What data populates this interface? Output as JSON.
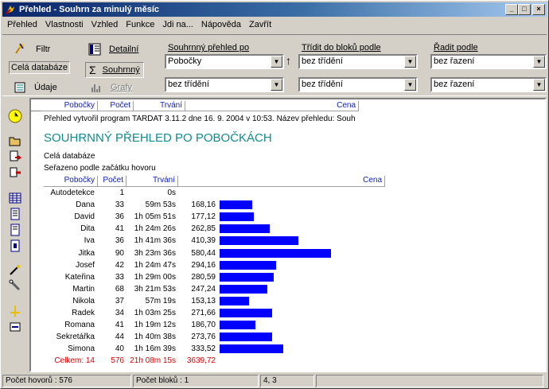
{
  "window": {
    "title": "Přehled - Souhrn za minulý měsíc",
    "min_label": "_",
    "max_label": "□",
    "close_label": "×"
  },
  "menu": [
    "Přehled",
    "Vlastnosti",
    "Vzhled",
    "Funkce",
    "Jdi na...",
    "Nápověda",
    "Zavřít"
  ],
  "toolbar": {
    "filter": "Filtr",
    "database": "Celá databáze",
    "data": "Údaje",
    "detail": "Detailní",
    "summary": "Souhrnný",
    "graphs": "Grafy",
    "summary_by_label": "Souhrnný přehled po",
    "summary_by_value": "Pobočky",
    "summary_by_2": "bez třídění",
    "sort_blocks_label": "Třídit do bloků podle",
    "sort_blocks_value": "bez třídění",
    "sort_blocks_2": "bez třídění",
    "order_label": "Řadit podle",
    "order_value": "bez řazení",
    "order_2": "bez řazení",
    "sort_arrow": "↑"
  },
  "header_strip": [
    "Pobočky",
    "Počet",
    "Trvání",
    "Cena"
  ],
  "report": {
    "info": "Přehled vytvořil program TARDAT 3.11.2 dne 16. 9. 2004 v 10:53. Název přehledu: Souh",
    "title": "SOUHRNNÝ PŘEHLED PO POBOČKÁCH",
    "scope": "Celá databáze",
    "sorted": "Seřazeno podle začátku hovoru",
    "columns": [
      "Pobočky",
      "Počet",
      "Trvání",
      "Cena"
    ],
    "rows": [
      {
        "name": "Autodetekce",
        "count": "1",
        "time": "0s",
        "price": "",
        "value": 0
      },
      {
        "name": "Dana",
        "count": "33",
        "time": "59m 53s",
        "price": "168,16",
        "value": 168.16
      },
      {
        "name": "David",
        "count": "36",
        "time": "1h 05m 51s",
        "price": "177,12",
        "value": 177.12
      },
      {
        "name": "Dita",
        "count": "41",
        "time": "1h 24m 26s",
        "price": "262,85",
        "value": 262.85
      },
      {
        "name": "Iva",
        "count": "36",
        "time": "1h 41m 36s",
        "price": "410,39",
        "value": 410.39
      },
      {
        "name": "Jitka",
        "count": "90",
        "time": "3h 23m 36s",
        "price": "580,44",
        "value": 580.44
      },
      {
        "name": "Josef",
        "count": "42",
        "time": "1h 24m 47s",
        "price": "294,16",
        "value": 294.16
      },
      {
        "name": "Kateřina",
        "count": "33",
        "time": "1h 29m 00s",
        "price": "280,59",
        "value": 280.59
      },
      {
        "name": "Martin",
        "count": "68",
        "time": "3h 21m 53s",
        "price": "247,24",
        "value": 247.24
      },
      {
        "name": "Nikola",
        "count": "37",
        "time": "57m 19s",
        "price": "153,13",
        "value": 153.13
      },
      {
        "name": "Radek",
        "count": "34",
        "time": "1h 03m 25s",
        "price": "271,66",
        "value": 271.66
      },
      {
        "name": "Romana",
        "count": "41",
        "time": "1h 19m 12s",
        "price": "186,70",
        "value": 186.7
      },
      {
        "name": "Sekretářka",
        "count": "44",
        "time": "1h 40m 38s",
        "price": "273,76",
        "value": 273.76
      },
      {
        "name": "Simona",
        "count": "40",
        "time": "1h 16m 39s",
        "price": "333,52",
        "value": 333.52
      }
    ],
    "total": {
      "name": "Celkem: 14",
      "count": "576",
      "time": "21h 08m 15s",
      "price": "3639,72"
    },
    "bar_color": "#0000ff",
    "total_color": "#e00000"
  },
  "status": {
    "calls": "Počet hovorů : 576",
    "blocks": "Počet bloků : 1",
    "position": "4, 3"
  }
}
